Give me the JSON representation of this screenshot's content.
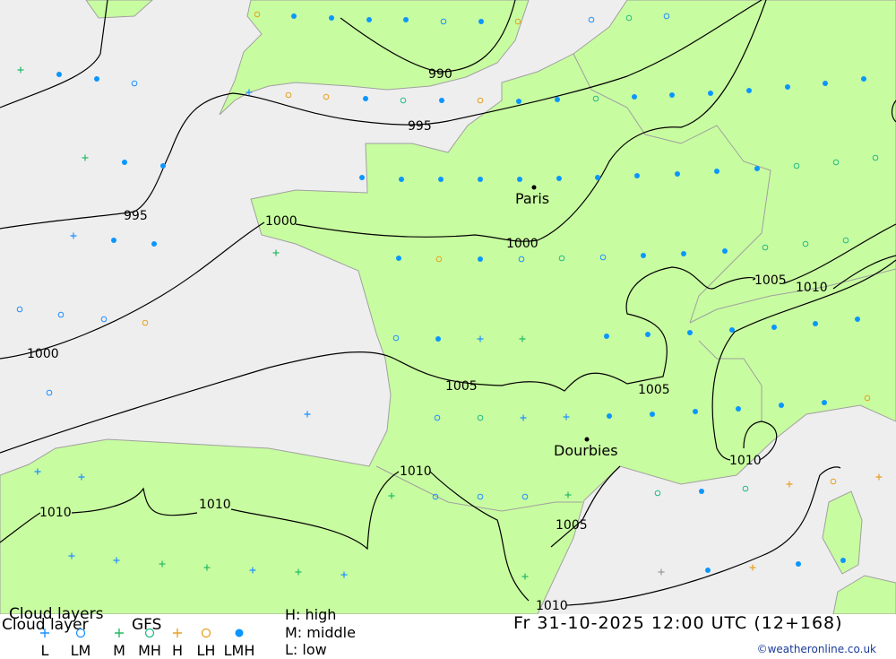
{
  "map": {
    "colors": {
      "land": "#c8fca0",
      "sea": "#eeeeee",
      "border": "#a0a0a0",
      "isobar": "#000000",
      "L": "#1e90ff",
      "LM": "#1e90ff",
      "LMH": "#0a96ff",
      "M": "#22bb66",
      "MH": "#22bb88",
      "H": "#e8a020",
      "LH": "#e8a020"
    },
    "isobar_labels": [
      "990",
      "995",
      "995",
      "1000",
      "1000",
      "1000",
      "1005",
      "1005",
      "1005",
      "1005",
      "1010",
      "1010",
      "1010",
      "1010",
      "1010",
      "1010"
    ],
    "cities": [
      {
        "name": "Paris"
      },
      {
        "name": "Dourbies"
      }
    ]
  },
  "legend": {
    "title": "Cloud layers",
    "subtitle": "Cloud layer",
    "model": "GFS",
    "items": [
      {
        "code": "L",
        "icon": "plus"
      },
      {
        "code": "LM",
        "icon": "circle"
      },
      {
        "code": "M",
        "icon": "plus"
      },
      {
        "code": "MH",
        "icon": "circle"
      },
      {
        "code": "H",
        "icon": "plus"
      },
      {
        "code": "LH",
        "icon": "circle"
      },
      {
        "code": "LMH",
        "icon": "filled-dot"
      }
    ],
    "key": {
      "high": "H:  high",
      "middle": "M:  middle",
      "low": "L:  low"
    }
  },
  "footer": {
    "datetime": "Fr 31-10-2025 12:00 UTC (12+168)",
    "copyright": "©weatheronline.co.uk"
  }
}
